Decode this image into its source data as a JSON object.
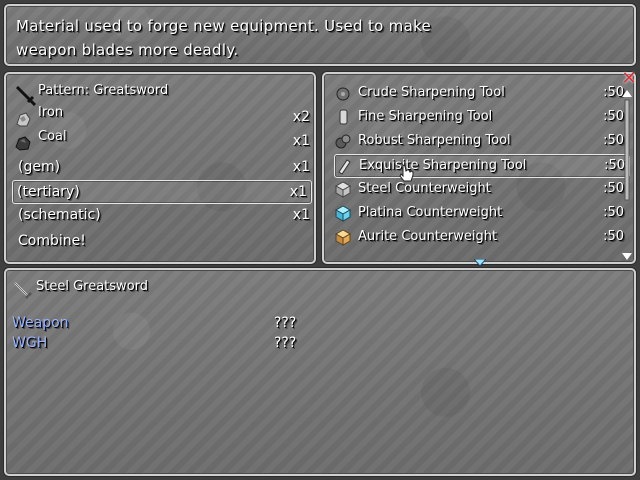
{
  "description": {
    "line1": "Material used to forge new equipment. Used to make",
    "line2": "weapon blades more deadly."
  },
  "recipe": {
    "pattern_label": "Pattern: Greatsword",
    "ingredients": [
      {
        "name": "Iron",
        "qty": "x2",
        "icon": "iron-ore-icon"
      },
      {
        "name": "Coal",
        "qty": "x1",
        "icon": "coal-icon"
      },
      {
        "name": "(gem)",
        "qty": "x1"
      },
      {
        "name": "(tertiary)",
        "qty": "x1"
      },
      {
        "name": "(schematic)",
        "qty": "x1"
      }
    ],
    "combine_label": "Combine!"
  },
  "tools": {
    "items": [
      {
        "name": "Crude Sharpening Tool",
        "qty": ":50",
        "icon": "crude-tool-icon"
      },
      {
        "name": "Fine Sharpening Tool",
        "qty": ":50",
        "icon": "fine-tool-icon"
      },
      {
        "name": "Robust Sharpening Tool",
        "qty": ":50",
        "icon": "robust-tool-icon"
      },
      {
        "name": "Exquisite Sharpening Tool",
        "qty": ":50",
        "icon": "exquisite-tool-icon"
      },
      {
        "name": "Steel Counterweight",
        "qty": ":50",
        "icon": "steel-cube-icon"
      },
      {
        "name": "Platina Counterweight",
        "qty": ":50",
        "icon": "platina-cube-icon"
      },
      {
        "name": "Aurite Counterweight",
        "qty": ":50",
        "icon": "aurite-cube-icon"
      }
    ],
    "selected_index": 3
  },
  "result": {
    "item_name": "Steel Greatsword",
    "stats": [
      {
        "label": "Weapon",
        "value": "???"
      },
      {
        "label": "WGH",
        "value": "???"
      }
    ]
  },
  "colors": {
    "stat_label": "#9ab4ff",
    "close": "#e0303a",
    "window_border": "#cfcfcf"
  }
}
